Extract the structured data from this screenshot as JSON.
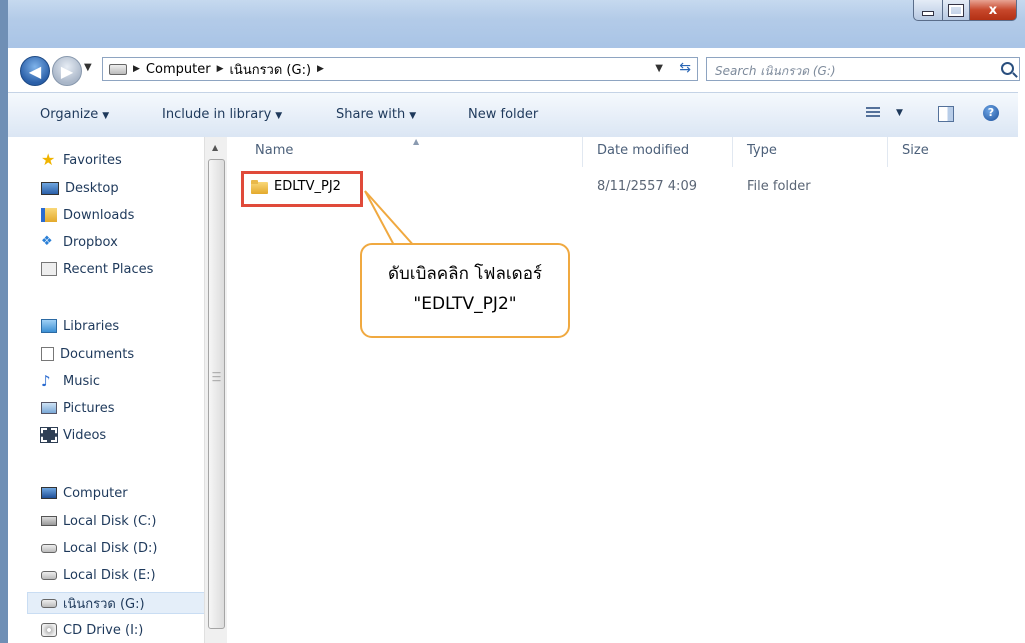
{
  "window": {
    "close_glyph": "x"
  },
  "address_bar": {
    "crumbs": [
      "Computer",
      "เนินกรวด (G:)"
    ],
    "search_placeholder": "Search เนินกรวด (G:)"
  },
  "command_bar": {
    "organize": "Organize",
    "include_in_library": "Include in library",
    "share_with": "Share with",
    "new_folder": "New folder"
  },
  "nav_pane": {
    "favorites": {
      "label": "Favorites",
      "items": [
        "Desktop",
        "Downloads",
        "Dropbox",
        "Recent Places"
      ]
    },
    "libraries": {
      "label": "Libraries",
      "items": [
        "Documents",
        "Music",
        "Pictures",
        "Videos"
      ]
    },
    "computer": {
      "label": "Computer",
      "items": [
        "Local Disk (C:)",
        "Local Disk (D:)",
        "Local Disk (E:)",
        "เนินกรวด (G:)",
        "CD Drive (I:)"
      ]
    },
    "selected": "เนินกรวด (G:)"
  },
  "columns": [
    "Name",
    "Date modified",
    "Type",
    "Size"
  ],
  "rows": [
    {
      "name": "EDLTV_PJ2",
      "date_modified": "8/11/2557 4:09",
      "type": "File folder",
      "size": ""
    }
  ],
  "callout": {
    "line1": "ดับเบิลคลิก โฟลเดอร์",
    "line2": "\"EDLTV_PJ2\""
  },
  "colors": {
    "highlight": "#e04a3a",
    "callout_border": "#f0a940",
    "text": "#1e395b"
  }
}
